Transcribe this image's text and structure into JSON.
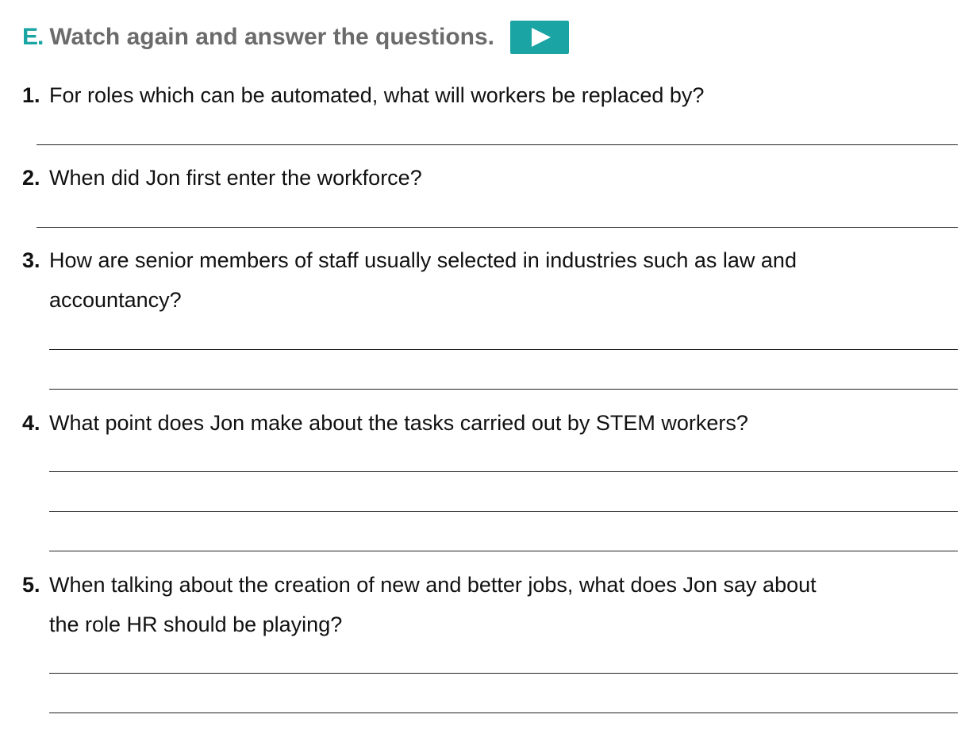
{
  "header": {
    "section_letter": "E.",
    "title": "Watch again and answer the questions.",
    "play_button_icon": "play-icon",
    "accent_color": "#1aa5a4"
  },
  "questions": [
    {
      "number": "1.",
      "line1": "For roles which can be automated, what will workers be replaced by?"
    },
    {
      "number": "2.",
      "line1": "When did Jon first enter the workforce?"
    },
    {
      "number": "3.",
      "line1": "How are senior members of staff usually selected in industries such as law and",
      "line2": "accountancy?"
    },
    {
      "number": "4.",
      "line1": "What point does Jon make about the tasks carried out by STEM workers?"
    },
    {
      "number": "5.",
      "line1": "When talking about the creation of new and better jobs, what does Jon say about",
      "line2": "the role HR should be playing?"
    }
  ]
}
